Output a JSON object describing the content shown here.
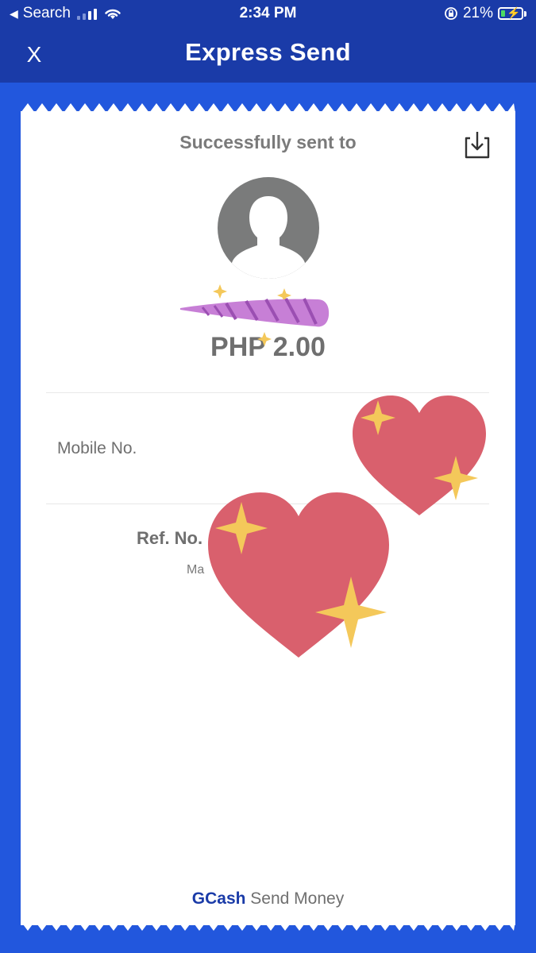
{
  "status_bar": {
    "back_label": "Search",
    "time": "2:34 PM",
    "battery_percent": "21%",
    "battery_level": 0.21
  },
  "nav": {
    "close_label": "X",
    "title": "Express Send"
  },
  "receipt": {
    "success_text": "Successfully sent to",
    "amount": "PHP 2.00",
    "mobile_label": "Mobile No.",
    "ref_label": "Ref. No.",
    "date_partial": "Ma",
    "footer_brand": "GCash",
    "footer_text": "Send Money"
  },
  "colors": {
    "nav_bg": "#1a3ba8",
    "page_bg": "#2257dd",
    "heart": "#d9606d",
    "sparkle": "#f4c85a",
    "horn": "#c77fd6"
  },
  "icons": {
    "download": "download-icon",
    "avatar": "person-silhouette-icon",
    "wifi": "wifi-icon",
    "signal": "signal-icon",
    "battery": "battery-charging-icon",
    "orientation_lock": "orientation-lock-icon"
  }
}
